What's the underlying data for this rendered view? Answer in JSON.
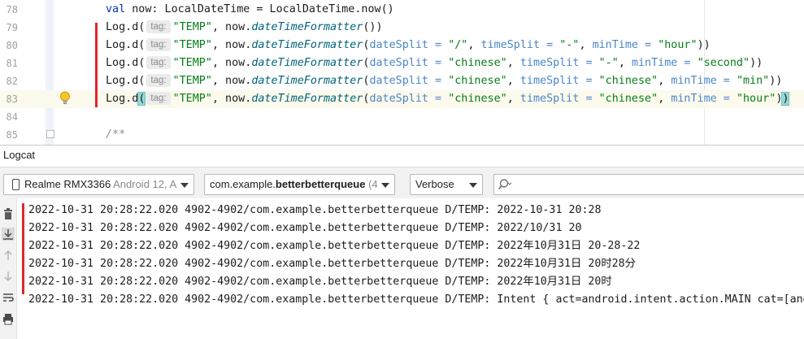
{
  "editor": {
    "lines": [
      {
        "num": "78",
        "segments": [
          {
            "t": "val",
            "c": "kw"
          },
          {
            "t": " now: LocalDateTime = LocalDateTime.now()",
            "c": ""
          }
        ]
      },
      {
        "num": "79",
        "segments": [
          {
            "t": "Log.d(",
            "c": ""
          },
          {
            "t": "tag:",
            "c": "hint"
          },
          {
            "t": "\"TEMP\"",
            "c": "str"
          },
          {
            "t": ", now.",
            "c": ""
          },
          {
            "t": "dateTimeFormatter",
            "c": "fn"
          },
          {
            "t": "())",
            "c": ""
          }
        ]
      },
      {
        "num": "80",
        "segments": [
          {
            "t": "Log.d(",
            "c": ""
          },
          {
            "t": "tag:",
            "c": "hint"
          },
          {
            "t": "\"TEMP\"",
            "c": "str"
          },
          {
            "t": ", now.",
            "c": ""
          },
          {
            "t": "dateTimeFormatter",
            "c": "fn"
          },
          {
            "t": "(",
            "c": ""
          },
          {
            "t": "dateSplit = ",
            "c": "param"
          },
          {
            "t": "\"/\"",
            "c": "str"
          },
          {
            "t": ", ",
            "c": ""
          },
          {
            "t": "timeSplit = ",
            "c": "param"
          },
          {
            "t": "\"-\"",
            "c": "str"
          },
          {
            "t": ", ",
            "c": ""
          },
          {
            "t": "minTime = ",
            "c": "param"
          },
          {
            "t": "\"hour\"",
            "c": "str"
          },
          {
            "t": "))",
            "c": ""
          }
        ]
      },
      {
        "num": "81",
        "segments": [
          {
            "t": "Log.d(",
            "c": ""
          },
          {
            "t": "tag:",
            "c": "hint"
          },
          {
            "t": "\"TEMP\"",
            "c": "str"
          },
          {
            "t": ", now.",
            "c": ""
          },
          {
            "t": "dateTimeFormatter",
            "c": "fn"
          },
          {
            "t": "(",
            "c": ""
          },
          {
            "t": "dateSplit = ",
            "c": "param"
          },
          {
            "t": "\"chinese\"",
            "c": "str"
          },
          {
            "t": ", ",
            "c": ""
          },
          {
            "t": "timeSplit = ",
            "c": "param"
          },
          {
            "t": "\"-\"",
            "c": "str"
          },
          {
            "t": ", ",
            "c": ""
          },
          {
            "t": "minTime = ",
            "c": "param"
          },
          {
            "t": "\"second\"",
            "c": "str"
          },
          {
            "t": "))",
            "c": ""
          }
        ]
      },
      {
        "num": "82",
        "segments": [
          {
            "t": "Log.d(",
            "c": ""
          },
          {
            "t": "tag:",
            "c": "hint"
          },
          {
            "t": "\"TEMP\"",
            "c": "str"
          },
          {
            "t": ", now.",
            "c": ""
          },
          {
            "t": "dateTimeFormatter",
            "c": "fn"
          },
          {
            "t": "(",
            "c": ""
          },
          {
            "t": "dateSplit = ",
            "c": "param"
          },
          {
            "t": "\"chinese\"",
            "c": "str"
          },
          {
            "t": ", ",
            "c": ""
          },
          {
            "t": "timeSplit = ",
            "c": "param"
          },
          {
            "t": "\"chinese\"",
            "c": "str"
          },
          {
            "t": ", ",
            "c": ""
          },
          {
            "t": "minTime = ",
            "c": "param"
          },
          {
            "t": "\"min\"",
            "c": "str"
          },
          {
            "t": "))",
            "c": ""
          }
        ]
      },
      {
        "num": "83",
        "current": true,
        "segments": [
          {
            "t": "Log.d",
            "c": ""
          },
          {
            "t": "(",
            "c": "bracket-hl"
          },
          {
            "t": "tag:",
            "c": "hint"
          },
          {
            "t": "\"TEMP\"",
            "c": "str"
          },
          {
            "t": ", now.",
            "c": ""
          },
          {
            "t": "dateTimeFormatter",
            "c": "fn"
          },
          {
            "t": "(",
            "c": ""
          },
          {
            "t": "dateSplit = ",
            "c": "param"
          },
          {
            "t": "\"chinese\"",
            "c": "str"
          },
          {
            "t": ", ",
            "c": ""
          },
          {
            "t": "timeSplit = ",
            "c": "param"
          },
          {
            "t": "\"chinese\"",
            "c": "str"
          },
          {
            "t": ", ",
            "c": ""
          },
          {
            "t": "minTime = ",
            "c": "param"
          },
          {
            "t": "\"hour\"",
            "c": "str"
          },
          {
            "t": ")",
            "c": ""
          },
          {
            "t": ")",
            "c": "bracket-hl"
          }
        ]
      },
      {
        "num": "84",
        "segments": []
      },
      {
        "num": "85",
        "segments": [
          {
            "t": "/**",
            "c": "cmt"
          }
        ]
      }
    ]
  },
  "logcat": {
    "title": "Logcat",
    "device": {
      "name": "Realme RMX3366",
      "detail": " Android 12, A"
    },
    "process": {
      "prefix": "com.example.",
      "bold": "betterbetterqueue",
      "suffix": " (4"
    },
    "level": "Verbose",
    "search": {
      "value": "",
      "placeholder": ""
    },
    "lines": [
      "2022-10-31 20:28:22.020 4902-4902/com.example.betterbetterqueue D/TEMP: 2022-10-31 20:28",
      "2022-10-31 20:28:22.020 4902-4902/com.example.betterbetterqueue D/TEMP: 2022/10/31 20",
      "2022-10-31 20:28:22.020 4902-4902/com.example.betterbetterqueue D/TEMP: 2022年10月31日 20-28-22",
      "2022-10-31 20:28:22.020 4902-4902/com.example.betterbetterqueue D/TEMP: 2022年10月31日 20时28分",
      "2022-10-31 20:28:22.020 4902-4902/com.example.betterbetterqueue D/TEMP: 2022年10月31日 20时",
      "2022-10-31 20:28:22.020 4902-4902/com.example.betterbetterqueue D/TEMP: Intent { act=android.intent.action.MAIN cat=[and"
    ],
    "side_icons": [
      "trash-icon",
      "scroll-to-end-icon",
      "up-arrow-icon",
      "down-arrow-icon",
      "soft-wrap-icon",
      "print-icon"
    ]
  },
  "colors": {
    "annotation_red": "#e0262d",
    "keyword": "#0033b3",
    "string": "#067d17",
    "param": "#4a86c7",
    "function": "#00627a"
  }
}
